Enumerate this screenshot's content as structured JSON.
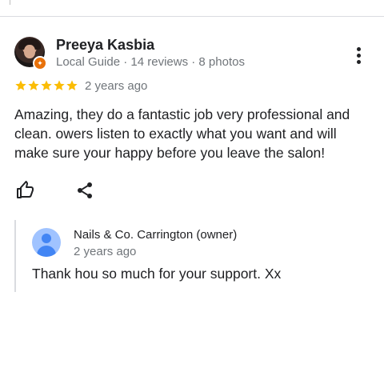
{
  "review": {
    "author_name": "Preeya Kasbia",
    "author_meta": "Local Guide · 14 reviews · 8 photos",
    "rating": 5,
    "time": "2 years ago",
    "text": "Amazing, they do a fantastic job very professional and clean. owers listen to exactly what you want and will make sure your happy before you leave the salon!",
    "star_color": "#fbbc04",
    "badge_color": "#e8710a"
  },
  "owner_reply": {
    "author": "Nails & Co. Carrington (owner)",
    "time": "2 years ago",
    "text": "Thank hou so much for your support. Xx",
    "avatar_color": "#4285f4"
  },
  "icons": {
    "more": "more-vert-icon",
    "like": "thumb-up-icon",
    "share": "share-icon",
    "star": "star-icon"
  }
}
